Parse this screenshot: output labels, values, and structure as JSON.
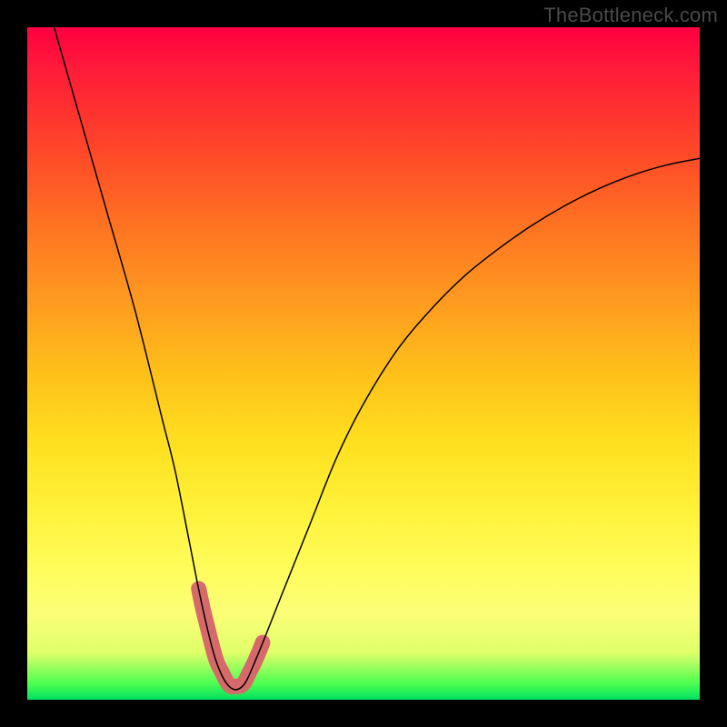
{
  "watermark": "TheBottleneck.com",
  "colors": {
    "frame": "#000000",
    "curve_thin": "#000000",
    "curve_thick": "#d66a6a",
    "gradient_top": "#ff0040",
    "gradient_bottom": "#00e060"
  },
  "chart_data": {
    "type": "line",
    "title": "",
    "xlabel": "",
    "ylabel": "",
    "xlim": [
      0,
      100
    ],
    "ylim": [
      0,
      100
    ],
    "grid": false,
    "series": [
      {
        "name": "bottleneck-curve",
        "x": [
          4,
          8,
          12,
          16,
          20,
          22,
          24,
          26,
          28,
          30,
          32,
          34,
          38,
          42,
          46,
          50,
          55,
          60,
          65,
          70,
          75,
          80,
          85,
          90,
          95,
          100
        ],
        "y": [
          100,
          86,
          72,
          58,
          42,
          34,
          24,
          14,
          6,
          2,
          2,
          6,
          16,
          26,
          36,
          44,
          52,
          58,
          63,
          67,
          70.5,
          73.5,
          76,
          78,
          79.5,
          80.5
        ]
      }
    ],
    "highlight_range_x": [
      25.5,
      35
    ],
    "note": "x/y are percentages of plot area (0,0 = bottom-left). Values estimated from pixels; chart has no axis ticks or labels."
  }
}
